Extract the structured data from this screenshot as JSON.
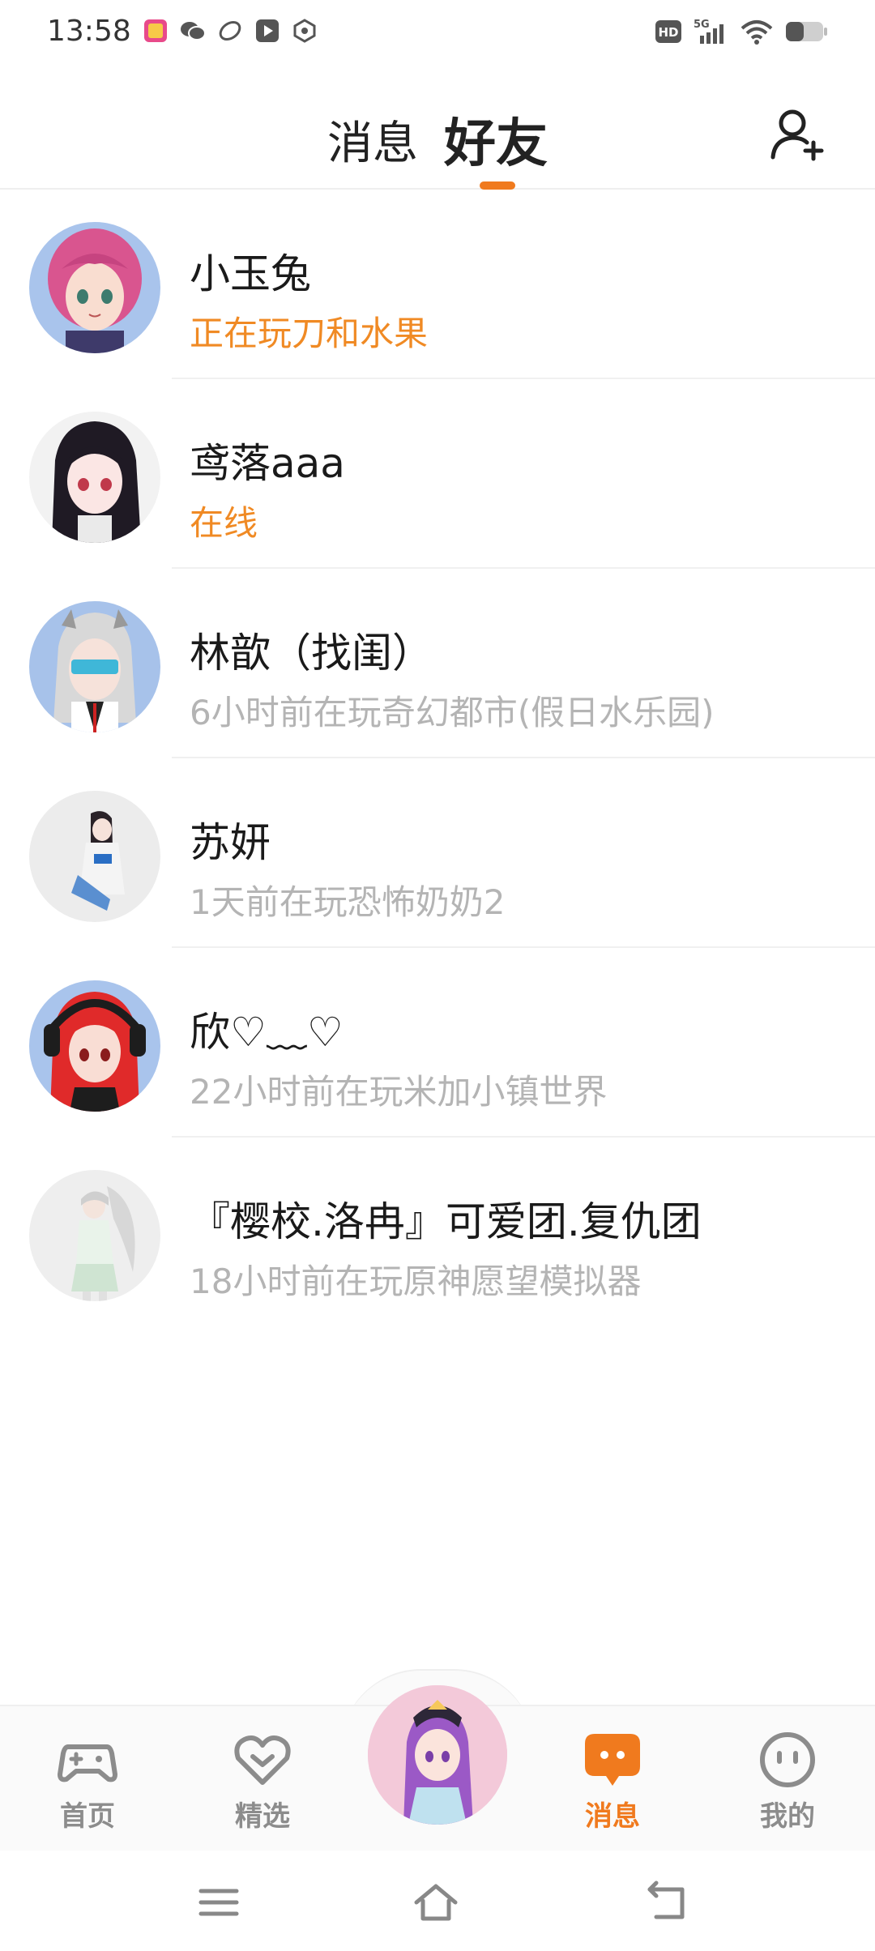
{
  "status_bar": {
    "time": "13:58",
    "app_icons": [
      "app-store-icon",
      "wechat-icon",
      "game-icon",
      "video-icon",
      "settings-hex-icon"
    ],
    "network_badge": "HD",
    "network_type": "5G"
  },
  "header": {
    "tab_messages": "消息",
    "tab_friends": "好友",
    "active_tab": "好友",
    "add_friend_icon": "add-user-icon"
  },
  "friends": [
    {
      "name": "小玉兔",
      "status": "正在玩刀和水果",
      "status_kind": "playing"
    },
    {
      "name": "鸢落aaa",
      "status": "在线",
      "status_kind": "online"
    },
    {
      "name": "林歆（找闺）",
      "status": "6小时前在玩奇幻都市(假日水乐园)",
      "status_kind": "offline"
    },
    {
      "name": "苏妍",
      "status": "1天前在玩恐怖奶奶2",
      "status_kind": "offline"
    },
    {
      "name": "欣♡﹏♡",
      "status": "22小时前在玩米加小镇世界",
      "status_kind": "offline"
    },
    {
      "name": "『樱校.洛冉』可爱团.复仇团",
      "status": "18小时前在玩原神愿望模拟器",
      "status_kind": "offline"
    }
  ],
  "bottom_nav": {
    "home": "首页",
    "featured": "精选",
    "messages": "消息",
    "mine": "我的",
    "active": "消息"
  },
  "colors": {
    "accent": "#f07a1e",
    "online_text": "#f08a24",
    "muted_text": "#b4b4b4",
    "nav_inactive": "#8c8c8c"
  }
}
